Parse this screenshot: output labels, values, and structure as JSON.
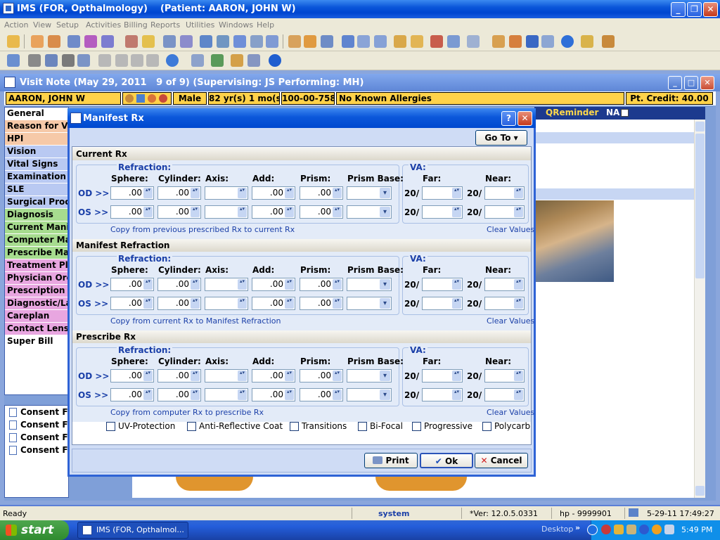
{
  "app": {
    "title": "IMS (FOR, Opthalmology)    (Patient: AARON, JOHN W)",
    "window_controls": [
      "_",
      "❐",
      "✕"
    ]
  },
  "menu": [
    "Action",
    "View",
    "Setup",
    "Activities",
    "Billing",
    "Reports",
    "Utilities",
    "Windows",
    "Help"
  ],
  "visit_note": {
    "title": "Visit Note (May 29, 2011   9 of 9) (Supervising: JS Performing: MH)",
    "patient_name": "AARON, JOHN W",
    "sex": "Male",
    "age": "82 yr(s) 1 mo(s)",
    "ssn": "100-00-7584",
    "allergies": "No Known Allergies",
    "credit": "Pt. Credit: 40.00",
    "qreminder": "QReminder",
    "na": "NA"
  },
  "nav_items": [
    {
      "label": "General",
      "color": "#ffffff"
    },
    {
      "label": "Reason for Visit",
      "color": "#f6c9a8"
    },
    {
      "label": "HPI",
      "color": "#f6c9a8"
    },
    {
      "label": "Vision",
      "color": "#b9c9f2"
    },
    {
      "label": "Vital Signs",
      "color": "#b9c9f2"
    },
    {
      "label": "Examination",
      "color": "#b9c9f2"
    },
    {
      "label": "SLE",
      "color": "#b9c9f2"
    },
    {
      "label": "Surgical Procedures",
      "color": "#b9c9f2"
    },
    {
      "label": "Diagnosis",
      "color": "#a7dc8f"
    },
    {
      "label": "Current Manifest",
      "color": "#a7dc8f"
    },
    {
      "label": "Computer Manifest",
      "color": "#a7dc8f"
    },
    {
      "label": "Prescribe Manifest",
      "color": "#a7dc8f"
    },
    {
      "label": "Treatment Plan",
      "color": "#e8a6e0"
    },
    {
      "label": "Physician Orders",
      "color": "#e8a6e0"
    },
    {
      "label": "Prescription",
      "color": "#e8a6e0"
    },
    {
      "label": "Diagnostic/Lab",
      "color": "#e8a6e0"
    },
    {
      "label": "Careplan",
      "color": "#e8a6e0"
    },
    {
      "label": "Contact Lens Fit",
      "color": "#e8a6e0"
    },
    {
      "label": "Super Bill",
      "color": "#ffffff"
    }
  ],
  "consent_items": [
    "Consent Form",
    "Consent Form",
    "Consent Form",
    "Consent Form"
  ],
  "dialog": {
    "title": "Manifest Rx",
    "help": "?",
    "goto": "Go To",
    "labels": {
      "refraction": "Refraction:",
      "sphere": "Sphere:",
      "cylinder": "Cylinder:",
      "axis": "Axis:",
      "add": "Add:",
      "prism": "Prism:",
      "prism_base": "Prism Base:",
      "va": "VA:",
      "far": "Far:",
      "near": "Near:",
      "od": "OD >>",
      "os": "OS >>",
      "twenty": "20/",
      "clear": "Clear Values"
    },
    "sections": [
      {
        "title": "Current Rx",
        "copy_link": "Copy from previous prescribed Rx to current Rx",
        "od": {
          "sphere": ".00",
          "cylinder": ".00",
          "axis": "",
          "add": ".00",
          "prism": ".00"
        },
        "os": {
          "sphere": ".00",
          "cylinder": ".00",
          "axis": "",
          "add": ".00",
          "prism": ".00"
        }
      },
      {
        "title": "Manifest Refraction",
        "copy_link": "Copy from current Rx to Manifest Refraction",
        "od": {
          "sphere": ".00",
          "cylinder": ".00",
          "axis": "",
          "add": ".00",
          "prism": ".00"
        },
        "os": {
          "sphere": ".00",
          "cylinder": ".00",
          "axis": "",
          "add": ".00",
          "prism": ".00"
        }
      },
      {
        "title": "Prescribe Rx",
        "copy_link": "Copy from computer Rx to prescribe Rx",
        "od": {
          "sphere": ".00",
          "cylinder": ".00",
          "axis": "",
          "add": ".00",
          "prism": ".00"
        },
        "os": {
          "sphere": ".00",
          "cylinder": ".00",
          "axis": "",
          "add": ".00",
          "prism": ".00"
        }
      }
    ],
    "options": [
      "UV-Protection",
      "Anti-Reflective Coat",
      "Transitions",
      "Bi-Focal",
      "Progressive",
      "Polycarb"
    ],
    "buttons": {
      "print": "Print",
      "ok": "Ok",
      "cancel": "Cancel"
    }
  },
  "status": {
    "ready": "Ready",
    "user": "system",
    "version": "*Ver: 12.0.5.0331",
    "phone": "hp - 9999901",
    "datetime": "5-29-11 17:49:27"
  },
  "taskbar": {
    "start": "start",
    "task": "IMS (FOR, Opthalmol...",
    "desktop": "Desktop",
    "clock": "5:49 PM"
  },
  "colors": {
    "accent": "#0a55d9",
    "patient_bar": "#ffd24a",
    "dialog_bg": "#cfdcf5"
  }
}
